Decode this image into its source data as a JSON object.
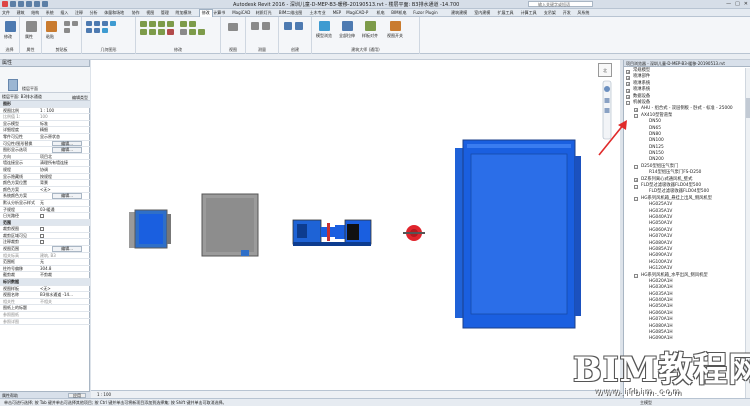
{
  "titlebar": {
    "title": "Autodesk Revit 2016 -   深圳儿童-D-MEP-B3-暖移-20190513.rvt - 楼层平面: B3排水通道 -14.700",
    "search_placeholder": "输入关键字或短语",
    "winbtns": [
      "—",
      "□",
      "✕"
    ]
  },
  "tabs": [
    "文件",
    "建筑",
    "结构",
    "系统",
    "插入",
    "注释",
    "分析",
    "体量和场地",
    "协作",
    "视图",
    "管理",
    "附加模块",
    "修改",
    "计算书",
    "MagiCAD",
    "材质灯光",
    "BIM二维出图",
    "土木专业",
    "MEP",
    "MagiCAD-P",
    "机电",
    "BIM机电",
    "Fuzor Plugin",
    "建筑建模",
    "室内建模",
    "扩展工具",
    "计算工具",
    "支吊架",
    "开发",
    "风系统"
  ],
  "active_tab": "修改",
  "ribbon": {
    "groups": [
      "选择",
      "属性",
      "剪贴板",
      "几何图形",
      "视图",
      "测量",
      "创建",
      "修改",
      "视图",
      "测量",
      "建筑大师 (通用)"
    ],
    "buttons": [
      "修改",
      "属性",
      "粘贴",
      "剪切",
      "连接",
      "视图",
      "测量",
      "创建",
      "移动",
      "复制",
      "镜像",
      "视图",
      "测量",
      "隐藏",
      "模型浏览",
      "全部拉伸",
      "样板对齐",
      "视图开关",
      "模型显示"
    ]
  },
  "options_bar": "",
  "properties": {
    "header": "属性",
    "type_name": "楼层平面",
    "selector": "楼层平面: B3排水通道",
    "edit_type": "编辑类型",
    "rows": [
      {
        "k": "图形",
        "v": "",
        "cat": true
      },
      {
        "k": "视图比例",
        "v": "1 : 100"
      },
      {
        "k": "比例值 1:",
        "v": "100",
        "grey": true
      },
      {
        "k": "显示模型",
        "v": "标准"
      },
      {
        "k": "详细程度",
        "v": "精细"
      },
      {
        "k": "零件可见性",
        "v": "显示原状态"
      },
      {
        "k": "可见性/图形替换",
        "btn": "编辑..."
      },
      {
        "k": "图形显示选项",
        "btn": "编辑..."
      },
      {
        "k": "方向",
        "v": "项目北"
      },
      {
        "k": "墙连接显示",
        "v": "清理所有墙连接"
      },
      {
        "k": "规程",
        "v": "协调"
      },
      {
        "k": "显示隐藏线",
        "v": "按规程"
      },
      {
        "k": "颜色方案位置",
        "v": "背景"
      },
      {
        "k": "颜色方案",
        "v": "<无>"
      },
      {
        "k": "系统颜色方案",
        "btn": "编辑..."
      },
      {
        "k": "默认分析显示样式",
        "v": "无"
      },
      {
        "k": "子规程",
        "v": "03-暖通"
      },
      {
        "k": "日光路径",
        "chk": true
      },
      {
        "k": "范围",
        "v": "",
        "cat": true
      },
      {
        "k": "裁剪视图",
        "chk": true
      },
      {
        "k": "裁剪区域可见",
        "chk": true
      },
      {
        "k": "注释裁剪",
        "chk": true
      },
      {
        "k": "视图范围",
        "btn": "编辑..."
      },
      {
        "k": "相关标高",
        "v": "建筑, B3",
        "grey": true
      },
      {
        "k": "范围框",
        "v": "无"
      },
      {
        "k": "柱符号偏移",
        "v": "304.8"
      },
      {
        "k": "截剪裁",
        "v": "不剪裁"
      },
      {
        "k": "标识数据",
        "v": "",
        "cat": true
      },
      {
        "k": "视图样板",
        "v": "<无>"
      },
      {
        "k": "视图名称",
        "v": "B3排水通道 -14..."
      },
      {
        "k": "相关性",
        "v": "不相关",
        "grey": true
      },
      {
        "k": "图纸上的标题",
        "v": ""
      },
      {
        "k": "参照图纸",
        "v": "",
        "grey": true
      },
      {
        "k": "参照详图",
        "v": "",
        "grey": true
      }
    ],
    "footer": "属性帮助",
    "apply": "应用"
  },
  "canvas": {
    "nav_cube": "北",
    "scale": "1 : 100"
  },
  "browser": {
    "header": "项目浏览器 - 深圳儿童-D-MEP-B3-暖移-20190513.rvt",
    "items": [
      {
        "t": "常规模型",
        "d": 1,
        "pm": "+"
      },
      {
        "t": "喷淋部件",
        "d": 1,
        "pm": "+"
      },
      {
        "t": "喷淋系统",
        "d": 1,
        "pm": "+"
      },
      {
        "t": "喷淋系统",
        "d": 1,
        "pm": "+"
      },
      {
        "t": "数据设备",
        "d": 1,
        "pm": "+"
      },
      {
        "t": "机械设备",
        "d": 1,
        "pm": "-"
      },
      {
        "t": "AHU - 组合式 - 双层侧板 - 卧式 - 标准 - 25000",
        "d": 2,
        "pm": "+"
      },
      {
        "t": "AX410型管道泵",
        "d": 2,
        "pm": "-"
      },
      {
        "t": "DN50",
        "d": 3
      },
      {
        "t": "DN65",
        "d": 3
      },
      {
        "t": "DN80",
        "d": 3
      },
      {
        "t": "DN100",
        "d": 3
      },
      {
        "t": "DN125",
        "d": 3
      },
      {
        "t": "DN150",
        "d": 3
      },
      {
        "t": "DN200",
        "d": 3
      },
      {
        "t": "D250型组压气泵门",
        "d": 2,
        "pm": "-"
      },
      {
        "t": "R14型组压气泵门FS-D250",
        "d": 3
      },
      {
        "t": "DZ系列离心式通风机_壁式",
        "d": 2,
        "pm": "+"
      },
      {
        "t": "FLD型过滤吸收器FLD04型500",
        "d": 2,
        "pm": "-"
      },
      {
        "t": "FLD型过滤吸收器FLD04型500",
        "d": 3
      },
      {
        "t": "HG系列风机箱_悬挂上出风_侧风机型",
        "d": 2,
        "pm": "-"
      },
      {
        "t": "HG025A1V",
        "d": 3
      },
      {
        "t": "HG035A1V",
        "d": 3
      },
      {
        "t": "HG040A1V",
        "d": 3
      },
      {
        "t": "HG050A1V",
        "d": 3
      },
      {
        "t": "HG060A1V",
        "d": 3
      },
      {
        "t": "HG070A1V",
        "d": 3
      },
      {
        "t": "HG080A1V",
        "d": 3
      },
      {
        "t": "HG085A1V",
        "d": 3
      },
      {
        "t": "HG090A1V",
        "d": 3
      },
      {
        "t": "HG100A1V",
        "d": 3
      },
      {
        "t": "HG120A1V",
        "d": 3
      },
      {
        "t": "HG系列风机箱_水平出风_侧风机型",
        "d": 2,
        "pm": "-"
      },
      {
        "t": "HG020A1H",
        "d": 3
      },
      {
        "t": "HG030A1H",
        "d": 3
      },
      {
        "t": "HG035A1H",
        "d": 3
      },
      {
        "t": "HG040A1H",
        "d": 3
      },
      {
        "t": "HG050A1H",
        "d": 3
      },
      {
        "t": "HG060A1H",
        "d": 3
      },
      {
        "t": "HG070A1H",
        "d": 3
      },
      {
        "t": "HG080A1H",
        "d": 3
      },
      {
        "t": "HG085A1H",
        "d": 3
      },
      {
        "t": "HG090A1H",
        "d": 3
      }
    ]
  },
  "status": {
    "left": "单击可进行选择; 按 Tab 键并单击可选择其他项目; 按 Ctrl 键并单击可将新项目添加到选择集; 按 Shift 键并单击可取消选择。",
    "right": "主模型"
  },
  "watermark": {
    "brand": "BIM教程网",
    "url": "www.ifbim.com"
  },
  "colors": {
    "equipment_blue": "#1a5fe0",
    "arrow_red": "#e02a2a"
  }
}
